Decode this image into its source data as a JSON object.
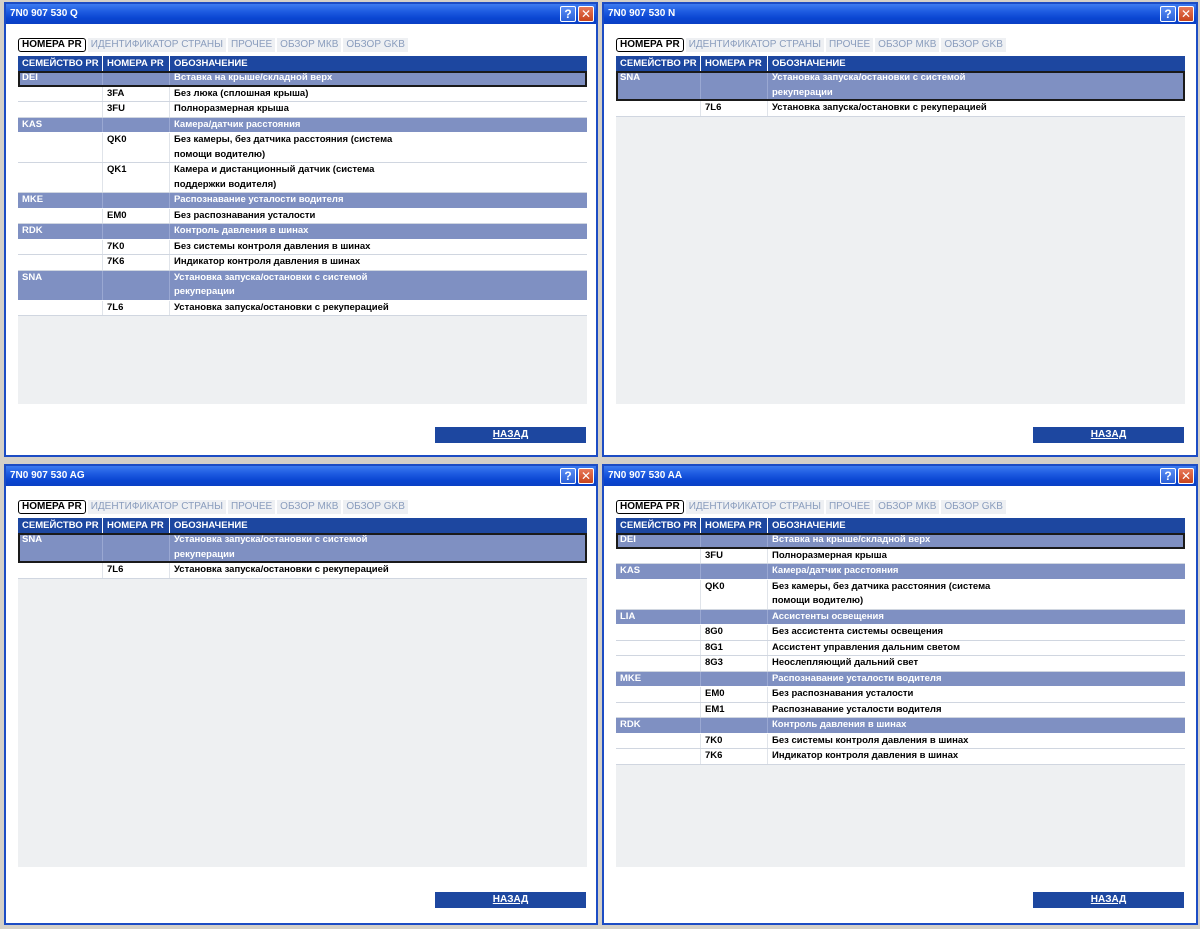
{
  "tabs": [
    "НОМЕРА PR",
    "ИДЕНТИФИКАТОР СТРАНЫ",
    "ПРОЧЕЕ",
    "ОБЗОР МКВ",
    "ОБЗОР GKB"
  ],
  "columns": {
    "family": "СЕМЕЙСТВО PR",
    "number": "НОМЕРА PR",
    "designation": "ОБОЗНАЧЕНИЕ"
  },
  "back_label": "НАЗАД",
  "help_glyph": "?",
  "close_glyph": "✕",
  "windows": [
    {
      "title": "7N0 907 530 Q",
      "rows": [
        {
          "type": "family",
          "fam": "DEI",
          "num": "",
          "des": "Вставка на крыше/складной верх",
          "selected": true
        },
        {
          "type": "item",
          "fam": "",
          "num": "3FA",
          "des": "Без люка (сплошная крыша)"
        },
        {
          "type": "item",
          "fam": "",
          "num": "3FU",
          "des": "Полноразмерная крыша"
        },
        {
          "type": "family",
          "fam": "KAS",
          "num": "",
          "des": "Камера/датчик расстояния"
        },
        {
          "type": "item",
          "fam": "",
          "num": "QK0",
          "des": "Без камеры, без датчика расстояния (система помощи водителю)"
        },
        {
          "type": "item",
          "fam": "",
          "num": "QK1",
          "des": "Камера и дистанционный датчик (система поддержки водителя)"
        },
        {
          "type": "family",
          "fam": "MKE",
          "num": "",
          "des": "Распознавание усталости водителя"
        },
        {
          "type": "item",
          "fam": "",
          "num": "EM0",
          "des": "Без распознавания усталости"
        },
        {
          "type": "family",
          "fam": "RDK",
          "num": "",
          "des": "Контроль давления в шинах"
        },
        {
          "type": "item",
          "fam": "",
          "num": "7K0",
          "des": "Без системы контроля давления в шинах"
        },
        {
          "type": "item",
          "fam": "",
          "num": "7K6",
          "des": "Индикатор контроля давления в шинах"
        },
        {
          "type": "family",
          "fam": "SNA",
          "num": "",
          "des": "Установка запуска/остановки с системой рекуперации"
        },
        {
          "type": "item",
          "fam": "",
          "num": "7L6",
          "des": "Установка запуска/остановки с рекуперацией"
        }
      ]
    },
    {
      "title": "7N0 907 530 N",
      "rows": [
        {
          "type": "family",
          "fam": "SNA",
          "num": "",
          "des": "Установка запуска/остановки с системой рекуперации",
          "selected": true
        },
        {
          "type": "item",
          "fam": "",
          "num": "7L6",
          "des": "Установка запуска/остановки с рекуперацией"
        }
      ]
    },
    {
      "title": "7N0 907 530 AG",
      "rows": [
        {
          "type": "family",
          "fam": "SNA",
          "num": "",
          "des": "Установка запуска/остановки с системой рекуперации",
          "selected": true
        },
        {
          "type": "item",
          "fam": "",
          "num": "7L6",
          "des": "Установка запуска/остановки с рекуперацией"
        }
      ]
    },
    {
      "title": "7N0 907 530 AA",
      "rows": [
        {
          "type": "family",
          "fam": "DEI",
          "num": "",
          "des": "Вставка на крыше/складной верх",
          "selected": true
        },
        {
          "type": "item",
          "fam": "",
          "num": "3FU",
          "des": "Полноразмерная крыша"
        },
        {
          "type": "family",
          "fam": "KAS",
          "num": "",
          "des": "Камера/датчик расстояния"
        },
        {
          "type": "item",
          "fam": "",
          "num": "QK0",
          "des": "Без камеры, без датчика расстояния (система помощи водителю)"
        },
        {
          "type": "family",
          "fam": "LIA",
          "num": "",
          "des": "Ассистенты освещения"
        },
        {
          "type": "item",
          "fam": "",
          "num": "8G0",
          "des": "Без ассистента системы освещения"
        },
        {
          "type": "item",
          "fam": "",
          "num": "8G1",
          "des": "Ассистент управления дальним светом"
        },
        {
          "type": "item",
          "fam": "",
          "num": "8G3",
          "des": "Неослепляющий дальний свет"
        },
        {
          "type": "family",
          "fam": "MKE",
          "num": "",
          "des": "Распознавание усталости водителя"
        },
        {
          "type": "item",
          "fam": "",
          "num": "EM0",
          "des": "Без распознавания усталости"
        },
        {
          "type": "item",
          "fam": "",
          "num": "EM1",
          "des": "Распознавание усталости водителя"
        },
        {
          "type": "family",
          "fam": "RDK",
          "num": "",
          "des": "Контроль давления в шинах"
        },
        {
          "type": "item",
          "fam": "",
          "num": "7K0",
          "des": "Без системы контроля давления в шинах"
        },
        {
          "type": "item",
          "fam": "",
          "num": "7K6",
          "des": "Индикатор контроля давления в шинах"
        }
      ]
    }
  ]
}
